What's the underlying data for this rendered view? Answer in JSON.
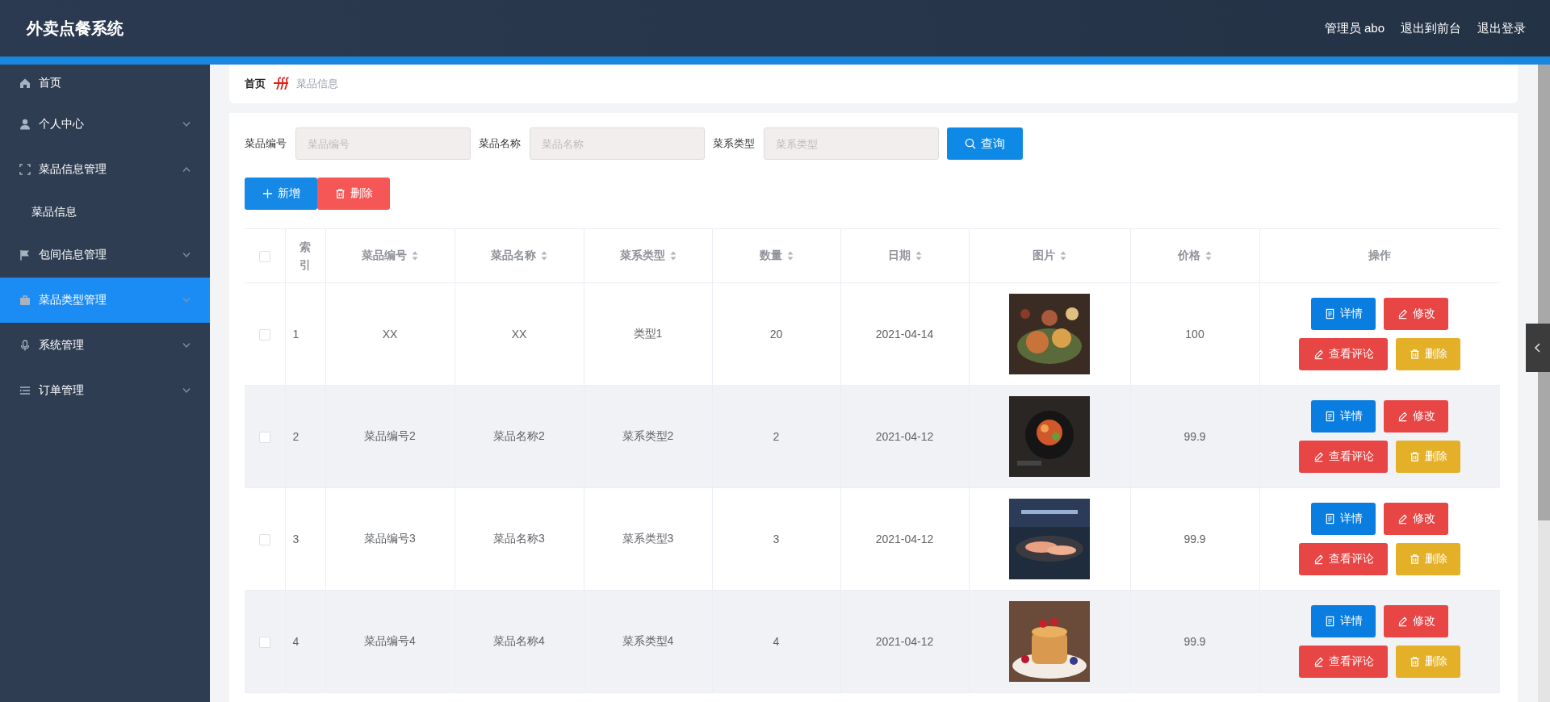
{
  "header": {
    "title": "外卖点餐系统",
    "links": [
      "管理员 abo",
      "退出到前台",
      "退出登录"
    ]
  },
  "sidebar": {
    "items": [
      {
        "label": "首页",
        "kind": "link",
        "selected": false
      },
      {
        "label": "个人中心",
        "kind": "menu",
        "expanded": false,
        "selected": false
      },
      {
        "label": "菜品信息管理",
        "kind": "menu",
        "expanded": true,
        "selected": false,
        "children": [
          {
            "label": "菜品信息",
            "selected": false
          }
        ]
      },
      {
        "label": "包间信息管理",
        "kind": "menu",
        "expanded": false,
        "selected": false
      },
      {
        "label": "菜品类型管理",
        "kind": "menu",
        "expanded": false,
        "selected": true
      },
      {
        "label": "系统管理",
        "kind": "menu",
        "expanded": false,
        "selected": false
      },
      {
        "label": "订单管理",
        "kind": "menu",
        "expanded": false,
        "selected": false
      }
    ]
  },
  "breadcrumb": [
    "首页",
    "菜品信息"
  ],
  "search": {
    "fields": [
      {
        "label": "菜品编号",
        "placeholder": "菜品编号"
      },
      {
        "label": "菜品名称",
        "placeholder": "菜品名称"
      },
      {
        "label": "菜系类型",
        "placeholder": "菜系类型"
      }
    ],
    "button": "查询"
  },
  "toolbar": [
    {
      "label": "新增",
      "kind": "add"
    },
    {
      "label": "删除",
      "kind": "delete"
    }
  ],
  "table": {
    "header_checked": false,
    "columns": [
      {
        "label": "索引",
        "sortable": false
      },
      {
        "label": "菜品编号",
        "sortable": true
      },
      {
        "label": "菜品名称",
        "sortable": true
      },
      {
        "label": "菜系类型",
        "sortable": true
      },
      {
        "label": "数量",
        "sortable": true
      },
      {
        "label": "日期",
        "sortable": true
      },
      {
        "label": "图片",
        "sortable": true
      },
      {
        "label": "价格",
        "sortable": true
      },
      {
        "label": "操作",
        "sortable": false
      }
    ],
    "rows": [
      {
        "checked": false,
        "index": "1",
        "code": "XX",
        "name": "XX",
        "type": "类型1",
        "quantity": "20",
        "date": "2021-04-14",
        "price": "100",
        "actions": [
          {
            "label": "详情",
            "kind": "detail"
          },
          {
            "label": "修改",
            "kind": "edit"
          },
          {
            "label": "查看评论",
            "kind": "comment"
          },
          {
            "label": "删除",
            "kind": "delete"
          }
        ]
      },
      {
        "checked": false,
        "index": "2",
        "code": "菜品编号2",
        "name": "菜品名称2",
        "type": "菜系类型2",
        "quantity": "2",
        "date": "2021-04-12",
        "price": "99.9",
        "actions": [
          {
            "label": "详情",
            "kind": "detail"
          },
          {
            "label": "修改",
            "kind": "edit"
          },
          {
            "label": "查看评论",
            "kind": "comment"
          },
          {
            "label": "删除",
            "kind": "delete"
          }
        ]
      },
      {
        "checked": false,
        "index": "3",
        "code": "菜品编号3",
        "name": "菜品名称3",
        "type": "菜系类型3",
        "quantity": "3",
        "date": "2021-04-12",
        "price": "99.9",
        "actions": [
          {
            "label": "详情",
            "kind": "detail"
          },
          {
            "label": "修改",
            "kind": "edit"
          },
          {
            "label": "查看评论",
            "kind": "comment"
          },
          {
            "label": "删除",
            "kind": "delete"
          }
        ]
      },
      {
        "checked": false,
        "index": "4",
        "code": "菜品编号4",
        "name": "菜品名称4",
        "type": "菜系类型4",
        "quantity": "4",
        "date": "2021-04-12",
        "price": "99.9",
        "actions": [
          {
            "label": "详情",
            "kind": "detail"
          },
          {
            "label": "修改",
            "kind": "edit"
          },
          {
            "label": "查看评论",
            "kind": "comment"
          },
          {
            "label": "删除",
            "kind": "delete"
          }
        ]
      }
    ]
  }
}
